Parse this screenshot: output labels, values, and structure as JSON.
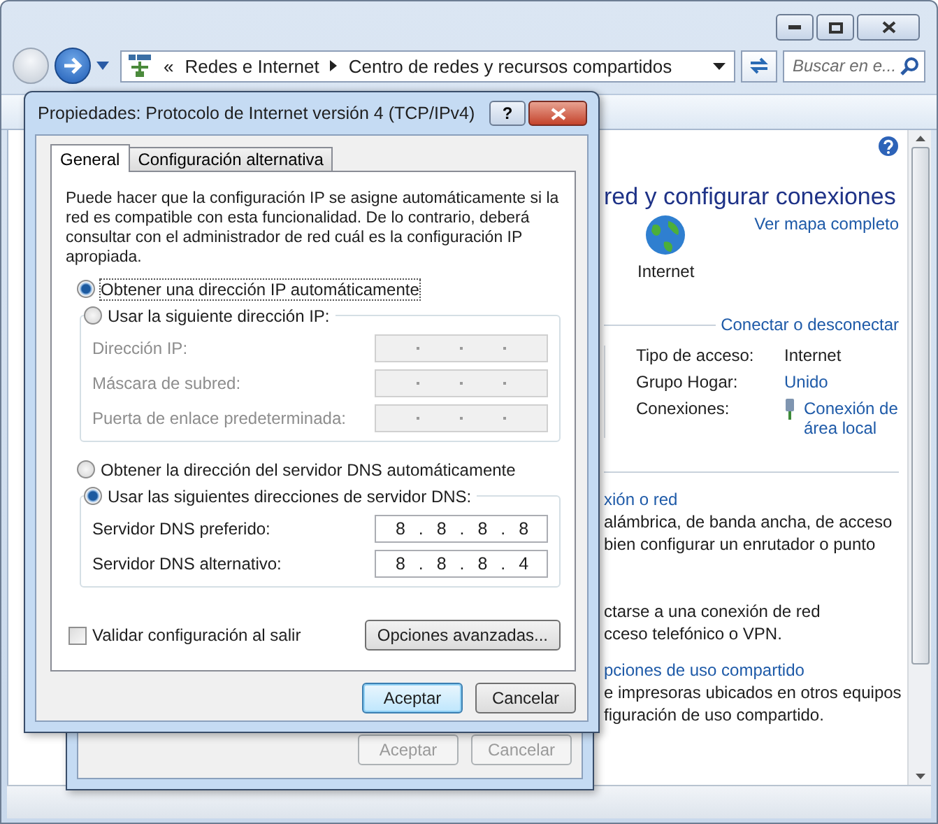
{
  "explorer": {
    "breadcrumb_prefix": "«",
    "breadcrumbs": [
      "Redes e Internet",
      "Centro de redes y recursos compartidos"
    ],
    "search": {
      "placeholder": "Buscar en e..."
    },
    "heading": "red y configurar conexiones",
    "map_link": "Ver mapa completo",
    "internet_label": "Internet",
    "connect_link": "Conectar o desconectar",
    "info": [
      {
        "label": "Tipo de acceso:",
        "value": "Internet",
        "link": false
      },
      {
        "label": "Grupo Hogar:",
        "value": "Unido",
        "link": true
      },
      {
        "label": "Conexiones:",
        "value": "Conexión de área local",
        "link": true
      }
    ],
    "sections": [
      {
        "title": "xión o red",
        "lines": [
          "alámbrica, de banda ancha, de acceso",
          "bien configurar un enrutador o punto"
        ]
      },
      {
        "lines": [
          "ctarse a una conexión de red",
          "cceso telefónico o VPN."
        ]
      },
      {
        "title": "pciones de uso compartido",
        "lines": [
          "e impresoras ubicados en otros equipos",
          "figuración de uso compartido."
        ]
      }
    ]
  },
  "back_dialog": {
    "buttons": [
      {
        "label": "Aceptar",
        "disabled": true
      },
      {
        "label": "Cancelar",
        "disabled": true
      }
    ]
  },
  "dialog": {
    "title": "Propiedades: Protocolo de Internet versión 4 (TCP/IPv4)",
    "help": "?",
    "tabs": [
      {
        "label": "General",
        "selected": true
      },
      {
        "label": "Configuración alternativa",
        "selected": false
      }
    ],
    "description": "Puede hacer que la configuración IP se asigne automáticamente si la red es compatible con esta funcionalidad. De lo contrario, deberá consultar con el administrador de red cuál es la configuración IP apropiada.",
    "ip_options": [
      {
        "label": "Obtener una dirección IP automáticamente",
        "selected": true
      },
      {
        "label": "Usar la siguiente dirección IP:",
        "selected": false
      }
    ],
    "ip_fields": [
      {
        "label": "Dirección IP:",
        "disabled": true
      },
      {
        "label": "Máscara de subred:",
        "disabled": true
      },
      {
        "label": "Puerta de enlace predeterminada:",
        "disabled": true
      }
    ],
    "dns_options": [
      {
        "label": "Obtener la dirección del servidor DNS automáticamente",
        "selected": false
      },
      {
        "label": "Usar las siguientes direcciones de servidor DNS:",
        "selected": true
      }
    ],
    "dns_fields": [
      {
        "label": "Servidor DNS preferido:",
        "value": "8 . 8 . 8 . 8",
        "disabled": false
      },
      {
        "label": "Servidor DNS alternativo:",
        "value": "8 . 8 . 8 . 4",
        "disabled": false
      }
    ],
    "validate": {
      "label": "Validar configuración al salir",
      "checked": false
    },
    "advanced_button": "Opciones avanzadas...",
    "buttons": [
      {
        "label": "Aceptar",
        "default": true
      },
      {
        "label": "Cancelar",
        "default": false
      }
    ]
  }
}
